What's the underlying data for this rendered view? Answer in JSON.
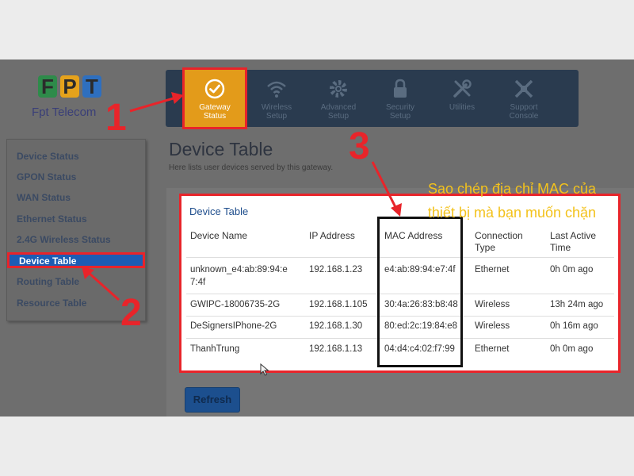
{
  "logo": {
    "mark": [
      "F",
      "P",
      "T"
    ],
    "text": "Fpt Telecom",
    "colors": [
      "#2e8b4a",
      "#e5a21c",
      "#2e6fbf"
    ]
  },
  "nav": {
    "items": [
      {
        "label": "Gateway Status",
        "icon": "checkmark-circle-icon",
        "active": true
      },
      {
        "label": "Wireless Setup",
        "icon": "wifi-icon"
      },
      {
        "label": "Advanced Setup",
        "icon": "gear-icon"
      },
      {
        "label": "Security Setup",
        "icon": "lock-icon"
      },
      {
        "label": "Utilities",
        "icon": "tools-icon"
      },
      {
        "label": "Support Console",
        "icon": "support-icon"
      }
    ]
  },
  "sidebar": {
    "items": [
      {
        "label": "Device Status"
      },
      {
        "label": "GPON Status"
      },
      {
        "label": "WAN Status"
      },
      {
        "label": "Ethernet Status"
      },
      {
        "label": "2.4G Wireless Status"
      },
      {
        "label": "Device Table",
        "active": true
      },
      {
        "label": "Routing Table"
      },
      {
        "label": "Resource Table"
      }
    ]
  },
  "page": {
    "title": "Device Table",
    "subtitle": "Here lists user devices served by this gateway."
  },
  "table": {
    "title": "Device Table",
    "headers": {
      "name": "Device Name",
      "ip": "IP Address",
      "mac": "MAC Address",
      "conn_1": "Connection",
      "conn_2": "Type",
      "last_1": "Last Active",
      "last_2": "Time"
    },
    "rows": [
      {
        "name_1": "unknown_e4:ab:89:94:e",
        "name_2": "7:4f",
        "ip": "192.168.1.23",
        "mac": "e4:ab:89:94:e7:4f",
        "conn": "Ethernet",
        "last": "0h 0m ago"
      },
      {
        "name_1": "GWIPC-18006735-2G",
        "name_2": "",
        "ip": "192.168.1.105",
        "mac": "30:4a:26:83:b8:48",
        "conn": "Wireless",
        "last": "13h 24m ago"
      },
      {
        "name_1": "DeSignersIPhone-2G",
        "name_2": "",
        "ip": "192.168.1.30",
        "mac": "80:ed:2c:19:84:e8",
        "conn": "Wireless",
        "last": "0h 16m ago"
      },
      {
        "name_1": "ThanhTrung",
        "name_2": "",
        "ip": "192.168.1.13",
        "mac": "04:d4:c4:02:f7:99",
        "conn": "Ethernet",
        "last": "0h 0m ago"
      }
    ]
  },
  "refresh_label": "Refresh",
  "annotations": {
    "step1": "1",
    "step2": "2",
    "step3": "3",
    "note_line1": "Sao chép địa chỉ MAC của",
    "note_line2": "thiết bị mà bạn muốn chặn"
  },
  "colors": {
    "highlight": "#e8242a",
    "active_nav": "#e39b1a",
    "nav_bg": "#2a3b4f",
    "note_text": "#f3c21c"
  }
}
